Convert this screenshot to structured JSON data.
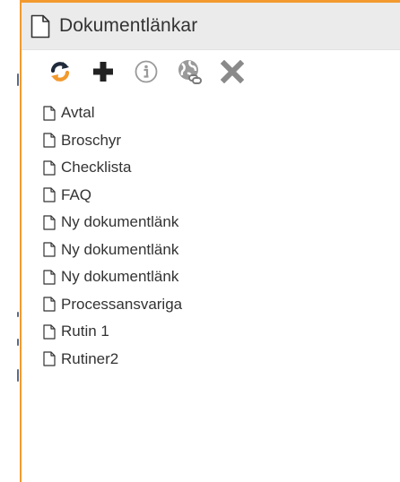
{
  "panel": {
    "title": "Dokumentlänkar",
    "accent_color": "#f29a2e",
    "header_background": "#ebebeb"
  },
  "toolbar": {
    "tools": [
      {
        "name": "refresh-icon",
        "color": "#f29a2e"
      },
      {
        "name": "add-icon",
        "color": "#222222"
      },
      {
        "name": "info-icon",
        "color": "#9a9a9a"
      },
      {
        "name": "web-link-icon",
        "color": "#9a9a9a"
      },
      {
        "name": "delete-icon",
        "color": "#8a8a8a"
      }
    ]
  },
  "documents": [
    {
      "label": "Avtal",
      "icon": "file-icon"
    },
    {
      "label": "Broschyr",
      "icon": "file-icon"
    },
    {
      "label": "Checklista",
      "icon": "file-icon"
    },
    {
      "label": "FAQ",
      "icon": "file-icon"
    },
    {
      "label": "Ny dokumentlänk",
      "icon": "file-icon"
    },
    {
      "label": "Ny dokumentlänk",
      "icon": "file-icon"
    },
    {
      "label": "Ny dokumentlänk",
      "icon": "file-icon"
    },
    {
      "label": "Processansvariga",
      "icon": "file-icon"
    },
    {
      "label": "Rutin 1",
      "icon": "file-icon"
    },
    {
      "label": "Rutiner2",
      "icon": "file-icon"
    }
  ]
}
